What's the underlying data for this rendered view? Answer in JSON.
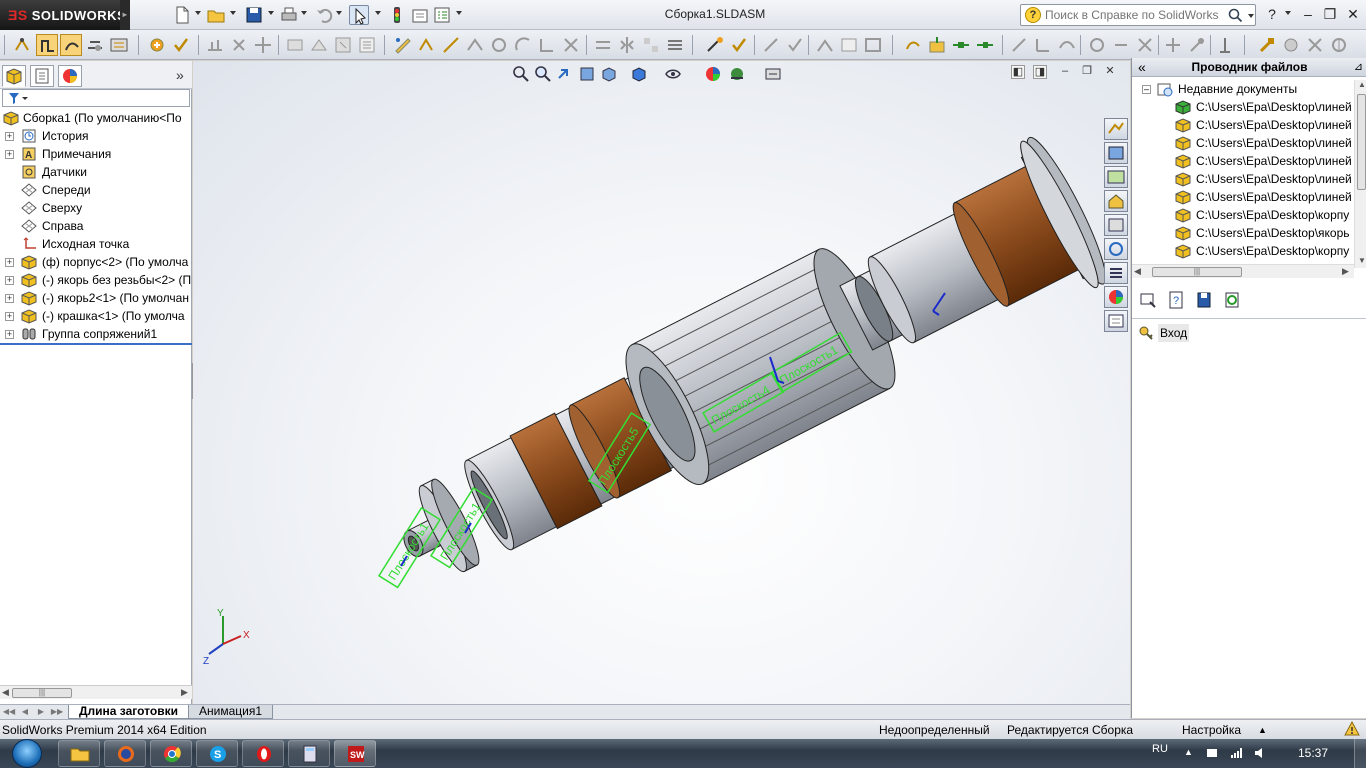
{
  "app": {
    "logo": "SOLIDWORKS",
    "document_title": "Сборка1.SLDASM"
  },
  "help_search": {
    "placeholder": "Поиск в Справке по SolidWorks"
  },
  "feature_tree": {
    "root": "Сборка1  (По умолчанию<По",
    "items": [
      {
        "label": "История",
        "icon": "history-icon",
        "expandable": true
      },
      {
        "label": "Примечания",
        "icon": "annotations-icon",
        "expandable": true
      },
      {
        "label": "Датчики",
        "icon": "sensors-icon",
        "expandable": false
      },
      {
        "label": "Спереди",
        "icon": "plane-icon",
        "expandable": false
      },
      {
        "label": "Сверху",
        "icon": "plane-icon",
        "expandable": false
      },
      {
        "label": "Справа",
        "icon": "plane-icon",
        "expandable": false
      },
      {
        "label": "Исходная точка",
        "icon": "origin-icon",
        "expandable": false
      },
      {
        "label": "(ф) порпус<2> (По умолча",
        "icon": "part-icon",
        "expandable": true
      },
      {
        "label": "(-) якорь без резьбы<2> (П",
        "icon": "part-icon",
        "expandable": true
      },
      {
        "label": "(-) якорь2<1> (По умолчан",
        "icon": "part-icon",
        "expandable": true
      },
      {
        "label": "(-) крашка<1> (По умолча",
        "icon": "part-icon",
        "expandable": true
      },
      {
        "label": "Группа сопряжений1",
        "icon": "mates-icon",
        "expandable": true
      }
    ]
  },
  "file_explorer": {
    "title": "Проводник файлов",
    "root": "Недавние документы",
    "items": [
      {
        "label": "C:\\Users\\Ера\\Desktop\\линей",
        "kind": "assembly"
      },
      {
        "label": "C:\\Users\\Ера\\Desktop\\линей",
        "kind": "part"
      },
      {
        "label": "C:\\Users\\Ера\\Desktop\\линей",
        "kind": "part"
      },
      {
        "label": "C:\\Users\\Ера\\Desktop\\линей",
        "kind": "part"
      },
      {
        "label": "C:\\Users\\Ера\\Desktop\\линей",
        "kind": "part"
      },
      {
        "label": "C:\\Users\\Ера\\Desktop\\линей",
        "kind": "part"
      },
      {
        "label": "C:\\Users\\Ера\\Desktop\\корпу",
        "kind": "part"
      },
      {
        "label": "C:\\Users\\Ера\\Desktop\\якорь",
        "kind": "part"
      },
      {
        "label": "C:\\Users\\Ера\\Desktop\\корпу",
        "kind": "part"
      }
    ],
    "login_label": "Вход"
  },
  "bottom_tabs": [
    {
      "label": "Длина заготовки",
      "active": true
    },
    {
      "label": "Анимация1",
      "active": false
    }
  ],
  "model_labels": [
    {
      "label": "Плоскость1"
    },
    {
      "label": "Плоскость1"
    },
    {
      "label": "Плоскость5"
    },
    {
      "label": "Плоскость4"
    },
    {
      "label": "Плоскость1"
    }
  ],
  "triad": {
    "x": "X",
    "y": "Y",
    "z": "Z"
  },
  "status": {
    "edition": "SolidWorks Premium 2014 x64 Edition",
    "definition": "Недоопределенный",
    "editing": "Редактируется Сборка",
    "settings": "Настройка"
  },
  "taskbar": {
    "language": "RU",
    "time": "15:37"
  },
  "colors": {
    "accent": "#3b6fc6",
    "part_gray": "#b9bdc4",
    "part_bronze": "#8a4a1c",
    "plane_green": "#33dd33"
  }
}
